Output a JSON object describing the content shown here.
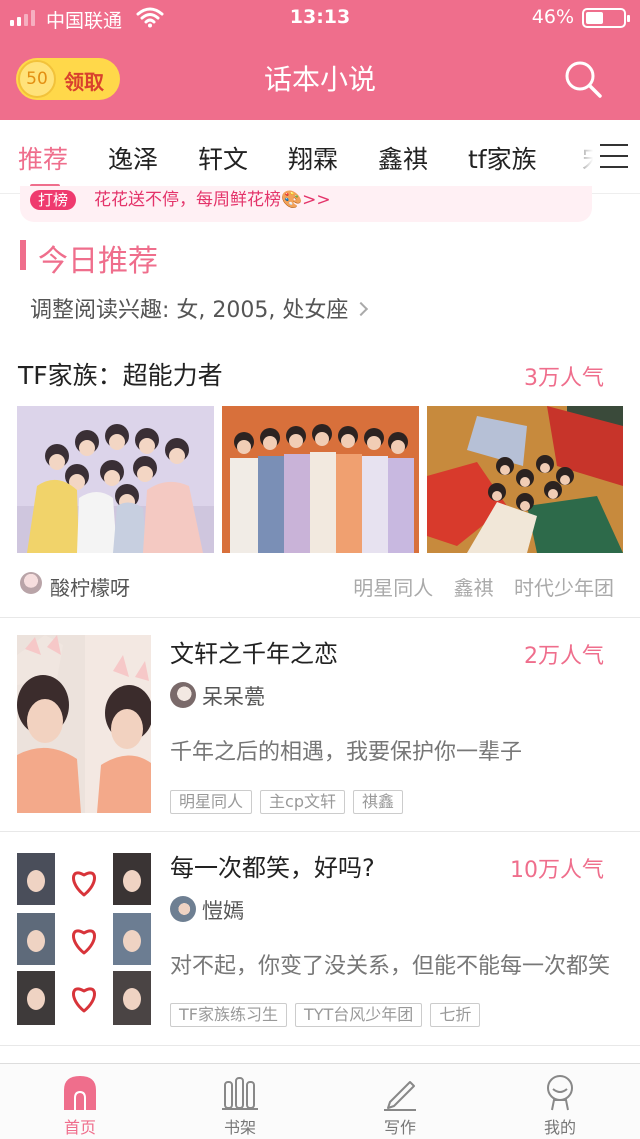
{
  "status_bar": {
    "carrier": "中国联通",
    "time": "13:13",
    "battery": "46%",
    "battery_level": 0.46
  },
  "header": {
    "coin_count": "50",
    "coin_label": "领取",
    "title": "话本小说"
  },
  "tabs": [
    "推荐",
    "逸泽",
    "轩文",
    "翔霖",
    "鑫祺",
    "tf家族",
    "宋"
  ],
  "banner": {
    "badge": "打榜",
    "text": "花花送不停，每周鲜花榜🎨>>"
  },
  "section": {
    "title": "今日推荐",
    "preference": "调整阅读兴趣: 女, 2005, 处女座"
  },
  "feature": {
    "title": "TF家族：超能力者",
    "popularity": "3万人气",
    "author": "酸柠檬呀",
    "tags": [
      "明星同人",
      "鑫祺",
      "时代少年团"
    ]
  },
  "stories": [
    {
      "title": "文轩之千年之恋",
      "popularity": "2万人气",
      "author": "呆呆甍",
      "desc": "千年之后的相遇，我要保护你一辈子",
      "tags": [
        "明星同人",
        "主cp文轩",
        "祺鑫"
      ]
    },
    {
      "title": "每一次都笑，好吗?",
      "popularity": "10万人气",
      "author": "愷嫣",
      "desc": "对不起，你变了没关系，但能不能每一次都笑",
      "tags": [
        "TF家族练习生",
        "TYT台风少年团",
        "七折"
      ]
    }
  ],
  "bottom_nav": [
    "首页",
    "书架",
    "写作",
    "我的"
  ],
  "colors": {
    "brand": "#ef6e8c",
    "coin": "#ffd84a"
  }
}
